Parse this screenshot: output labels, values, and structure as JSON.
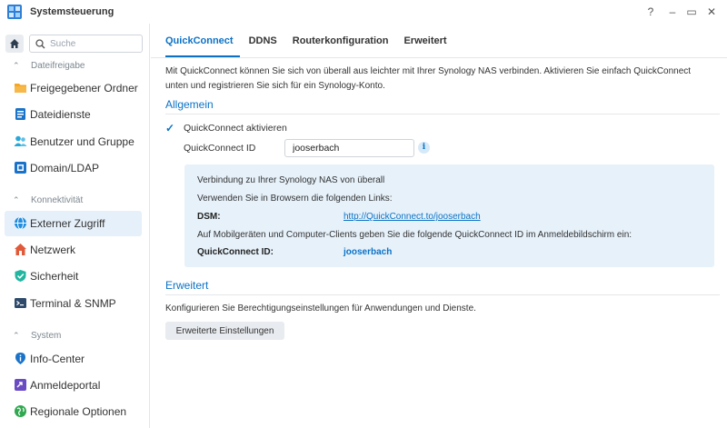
{
  "window": {
    "title": "Systemsteuerung",
    "controls": [
      "?",
      "–",
      "▭",
      "✕"
    ]
  },
  "sidebar": {
    "search_placeholder": "Suche",
    "sections": [
      {
        "label": "Dateifreigabe",
        "items": [
          {
            "label": "Freigegebener Ordner",
            "icon": "folder-icon",
            "color": "#f5a623"
          },
          {
            "label": "Dateidienste",
            "icon": "file-services-icon",
            "color": "#1a73c8"
          },
          {
            "label": "Benutzer und Gruppe",
            "icon": "users-icon",
            "color": "#27a8d8"
          },
          {
            "label": "Domain/LDAP",
            "icon": "domain-icon",
            "color": "#1a73c8"
          }
        ]
      },
      {
        "label": "Konnektivität",
        "items": [
          {
            "label": "Externer Zugriff",
            "icon": "external-access-icon",
            "color": "#1e8de0",
            "active": true
          },
          {
            "label": "Netzwerk",
            "icon": "network-home-icon",
            "color": "#e05a3a"
          },
          {
            "label": "Sicherheit",
            "icon": "security-shield-icon",
            "color": "#22b5a0"
          },
          {
            "label": "Terminal & SNMP",
            "icon": "terminal-icon",
            "color": "#2d4a6b"
          }
        ]
      },
      {
        "label": "System",
        "items": [
          {
            "label": "Info-Center",
            "icon": "info-center-icon",
            "color": "#1a73c8"
          },
          {
            "label": "Anmeldeportal",
            "icon": "login-portal-icon",
            "color": "#6a4bc4"
          },
          {
            "label": "Regionale Optionen",
            "icon": "regional-options-icon",
            "color": "#2fa84f"
          }
        ]
      }
    ]
  },
  "tabs": [
    "QuickConnect",
    "DDNS",
    "Routerkonfiguration",
    "Erweitert"
  ],
  "main": {
    "intro_line1": "Mit QuickConnect können Sie sich von überall aus leichter mit Ihrer Synology NAS verbinden. Aktivieren Sie einfach QuickConnect",
    "intro_line2": "unten und registrieren Sie sich für ein Synology-Konto.",
    "general_title": "Allgemein",
    "enable_label": "QuickConnect aktivieren",
    "enable_checked": true,
    "id_label": "QuickConnect ID",
    "id_value": "jooserbach",
    "panel": {
      "line1": "Verbindung zu Ihrer Synology NAS von überall",
      "line2": "Verwenden Sie in Browsern die folgenden Links:",
      "dsm_label": "DSM:",
      "dsm_link": "http://QuickConnect.to/jooserbach",
      "line3": "Auf Mobilgeräten und Computer-Clients geben Sie die folgende QuickConnect ID im Anmeldebildschirm ein:",
      "qc_label": "QuickConnect ID:",
      "qc_value": "jooserbach"
    },
    "advanced_title": "Erweitert",
    "advanced_desc": "Konfigurieren Sie Berechtigungseinstellungen für Anwendungen und Dienste.",
    "advanced_button": "Erweiterte Einstellungen"
  },
  "colors": {
    "accent": "#0b72c6",
    "active_item_bg": "#e6f0fa",
    "panel_bg": "#e6f1fa"
  }
}
